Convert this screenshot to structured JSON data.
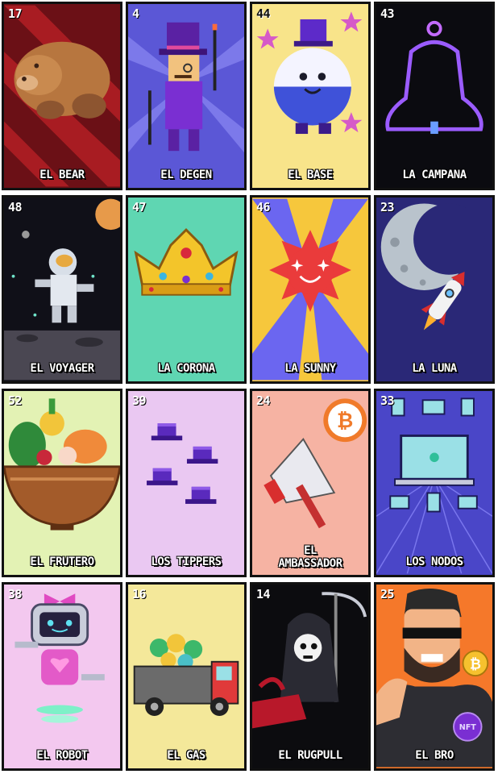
{
  "cards": [
    {
      "number": "17",
      "title": "EL BEAR",
      "subject": "bear"
    },
    {
      "number": "4",
      "title": "EL DEGEN",
      "subject": "degen-gentleman"
    },
    {
      "number": "44",
      "title": "EL BASE",
      "subject": "base-mascot"
    },
    {
      "number": "43",
      "title": "LA CAMPANA",
      "subject": "bell"
    },
    {
      "number": "48",
      "title": "EL VOYAGER",
      "subject": "astronaut"
    },
    {
      "number": "47",
      "title": "LA CORONA",
      "subject": "crown"
    },
    {
      "number": "46",
      "title": "LA  SUNNY",
      "subject": "sun"
    },
    {
      "number": "23",
      "title": "LA LUNA",
      "subject": "moon-rocket"
    },
    {
      "number": "52",
      "title": "EL FRUTERO",
      "subject": "fruit-bowl"
    },
    {
      "number": "39",
      "title": "LOS TIPPERS",
      "subject": "top-hats"
    },
    {
      "number": "24",
      "title": "EL\nAMBASSADOR",
      "subject": "megaphone-bitcoin"
    },
    {
      "number": "33",
      "title": "LOS NODOS",
      "subject": "network-laptops"
    },
    {
      "number": "38",
      "title": "EL ROBOT",
      "subject": "robot"
    },
    {
      "number": "16",
      "title": "EL GAS",
      "subject": "gas-truck"
    },
    {
      "number": "14",
      "title": "EL RUGPULL",
      "subject": "grim-reaper"
    },
    {
      "number": "25",
      "title": "EL BRO",
      "subject": "bro-bitcoin"
    }
  ],
  "badges": {
    "bitcoin_symbol": "₿",
    "nft_label": "NFT"
  }
}
